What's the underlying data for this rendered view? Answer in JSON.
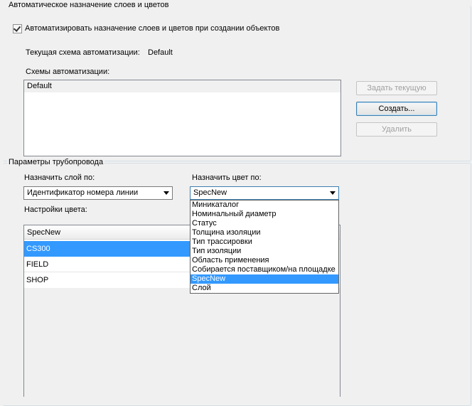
{
  "auto_group": {
    "title": "Автоматическое назначение слоев и цветов",
    "checkbox_label": "Автоматизировать назначение слоев и цветов при создании объектов",
    "checked": true,
    "current_scheme_label": "Текущая схема автоматизации:",
    "current_scheme_value": "Default",
    "schemes_label": "Схемы автоматизации:",
    "schemes": [
      "Default"
    ],
    "buttons": {
      "set_current": "Задать текущую",
      "create": "Создать...",
      "delete": "Удалить"
    }
  },
  "pipeline_group": {
    "title": "Параметры трубопровода",
    "assign_layer_label": "Назначить слой по:",
    "assign_layer_value": "Идентификатор номера линии",
    "assign_color_label": "Назначить цвет по:",
    "assign_color_value": "SpecNew",
    "color_settings_label": "Настройки цвета:",
    "color_dropdown_options": [
      "Миникаталог",
      "Номинальный диаметр",
      "Статус",
      "Толщина изоляции",
      "Тип трассировки",
      "Тип изоляции",
      "Область применения",
      "Собирается поставщиком/на площадке",
      "SpecNew",
      "Слой"
    ],
    "color_dropdown_selected": "SpecNew",
    "grid": {
      "header": "SpecNew",
      "rows": [
        "CS300",
        "FIELD",
        "SHOP"
      ],
      "selected_row": "CS300"
    }
  },
  "colors": {
    "selection": "#3399ff",
    "background": "#f0f0f0"
  }
}
